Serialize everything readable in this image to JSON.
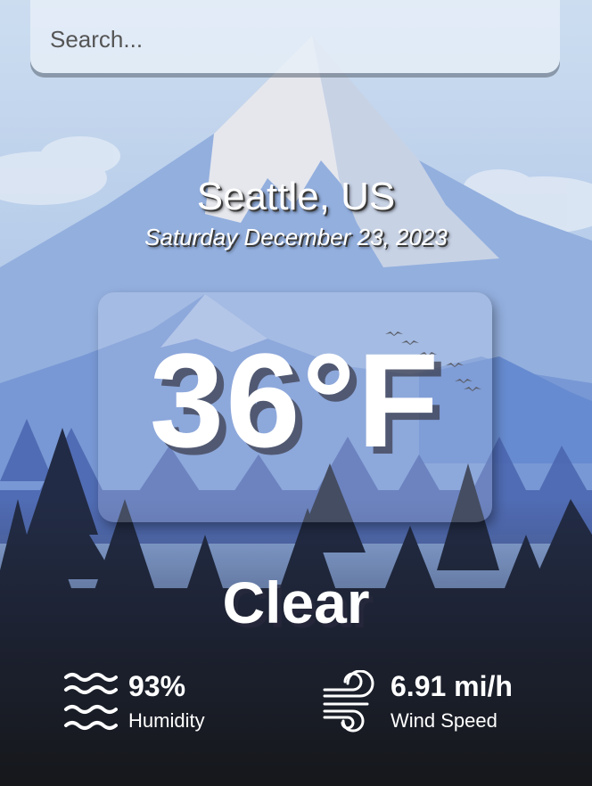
{
  "search": {
    "placeholder": "Search..."
  },
  "location": {
    "city": "Seattle, US",
    "date": "Saturday December 23, 2023"
  },
  "current": {
    "temperature": "36°F",
    "condition": "Clear"
  },
  "stats": {
    "humidity": {
      "value": "93%",
      "label": "Humidity",
      "icon": "waves-icon"
    },
    "wind": {
      "value": "6.91 mi/h",
      "label": "Wind Speed",
      "icon": "wind-icon"
    }
  },
  "colors": {
    "sky": "#a9c3e6",
    "mountain_snow": "#e6e8ee",
    "mountain_blue": "#7aa0d6",
    "forest_dark": "#0e1630",
    "text": "#ffffff"
  }
}
